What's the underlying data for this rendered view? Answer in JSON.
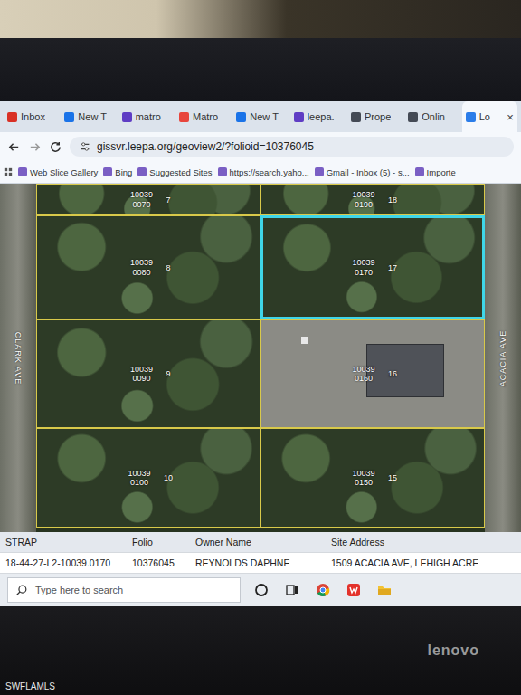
{
  "browser": {
    "tabs": [
      {
        "label": "Inbox",
        "selected": false,
        "color": "#d93025"
      },
      {
        "label": "New T",
        "selected": false,
        "color": "#1a73e8"
      },
      {
        "label": "matro",
        "selected": false,
        "color": "#5f3dc4"
      },
      {
        "label": "Matro",
        "selected": false,
        "color": "#e8453c"
      },
      {
        "label": "New T",
        "selected": false,
        "color": "#1a73e8"
      },
      {
        "label": "leepa.",
        "selected": false,
        "color": "#5f3dc4"
      },
      {
        "label": "Prope",
        "selected": false,
        "color": "#444a55"
      },
      {
        "label": "Onlin",
        "selected": false,
        "color": "#444a55"
      },
      {
        "label": "Lo",
        "selected": true,
        "color": "#2b7de9"
      }
    ],
    "close": "×",
    "url": "gissvr.leepa.org/geoview2/?folioid=10376045",
    "bookmarks": [
      "Web Slice Gallery",
      "Bing",
      "Suggested Sites",
      "https://search.yaho...",
      "Gmail - Inbox (5) - s...",
      "Importe"
    ]
  },
  "map": {
    "streets": [
      "CLARK AVE",
      "ACACIA AVE"
    ],
    "parcels": [
      {
        "strap": "10039 0070",
        "lot": "7",
        "selected": false,
        "kind": "lot"
      },
      {
        "strap": "10039 0190",
        "lot": "18",
        "selected": false,
        "kind": "lot"
      },
      {
        "strap": "10039 0080",
        "lot": "8",
        "selected": false,
        "kind": "lot"
      },
      {
        "strap": "10039 0170",
        "lot": "17",
        "selected": true,
        "kind": "lot"
      },
      {
        "strap": "10039 0090",
        "lot": "9",
        "selected": false,
        "kind": "lot"
      },
      {
        "strap": "10039 0160",
        "lot": "16",
        "selected": false,
        "kind": "house"
      },
      {
        "strap": "10039 0100",
        "lot": "10",
        "selected": false,
        "kind": "lot"
      },
      {
        "strap": "10039 0150",
        "lot": "15",
        "selected": false,
        "kind": "lot"
      }
    ]
  },
  "table": {
    "columns": [
      "STRAP",
      "Folio",
      "Owner Name",
      "Site Address"
    ],
    "rows": [
      [
        "18-44-27-L2-10039.0170",
        "10376045",
        "REYNOLDS DAPHNE",
        "1509 ACACIA AVE, LEHIGH ACRE"
      ]
    ]
  },
  "taskbar": {
    "search_placeholder": "Type here to search"
  },
  "device": {
    "brand": "lenovo"
  },
  "watermark": "SWFLAMLS"
}
